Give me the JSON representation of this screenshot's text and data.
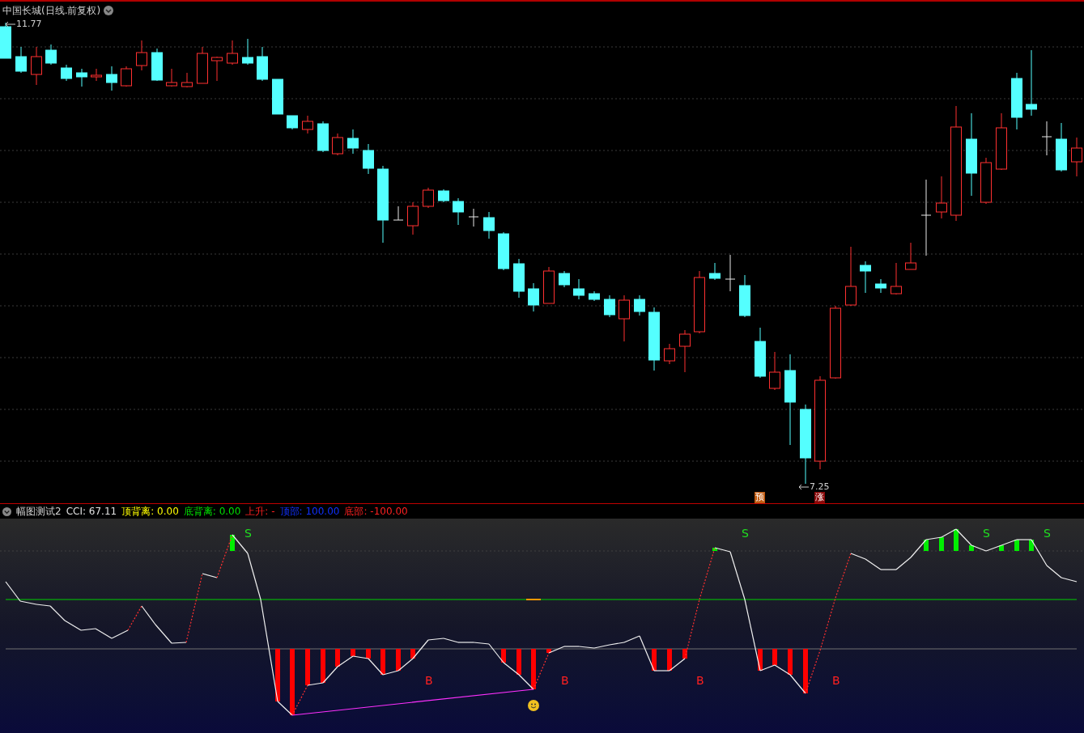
{
  "main_chart": {
    "title": "中国长城(日线.前复权)",
    "high_label": "11.77",
    "low_label": "7.25",
    "markers": [
      {
        "text": "预",
        "kind": "forecast"
      },
      {
        "text": "涨",
        "kind": "rise"
      }
    ]
  },
  "indicator": {
    "name": "幅图测试2",
    "readings": [
      {
        "label": "CCI:",
        "value": "67.11",
        "color": "#e0e0e0"
      },
      {
        "label": "顶背离:",
        "value": "0.00",
        "color": "#ffff00"
      },
      {
        "label": "底背离:",
        "value": "0.00",
        "color": "#00e000"
      },
      {
        "label": "上升:",
        "value": "-",
        "color": "#ff2020"
      },
      {
        "label": "顶部:",
        "value": "100.00",
        "color": "#1030ff"
      },
      {
        "label": "底部:",
        "value": "-100.00",
        "color": "#ff2020"
      }
    ],
    "signals": [
      {
        "text": "S",
        "kind": "sell"
      },
      {
        "text": "S",
        "kind": "sell"
      },
      {
        "text": "S",
        "kind": "sell"
      },
      {
        "text": "S",
        "kind": "sell"
      },
      {
        "text": "B",
        "kind": "buy"
      },
      {
        "text": "B",
        "kind": "buy"
      },
      {
        "text": "B",
        "kind": "buy"
      },
      {
        "text": "B",
        "kind": "buy"
      }
    ]
  }
}
